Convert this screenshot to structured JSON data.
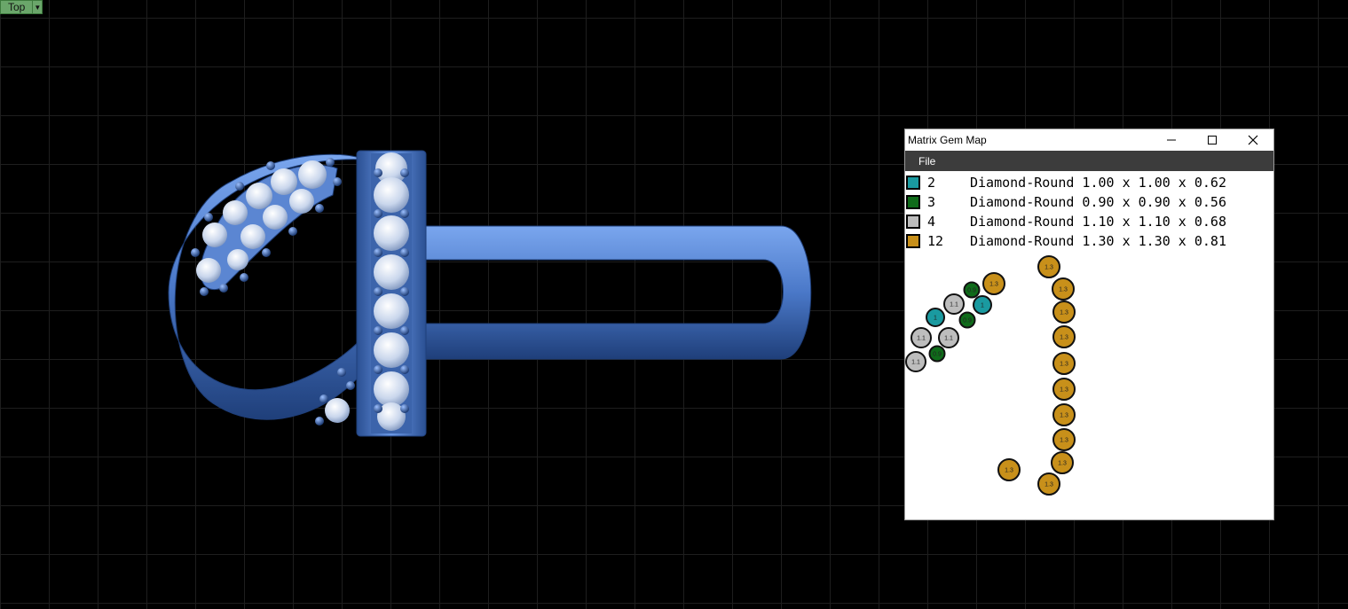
{
  "viewport": {
    "label": "Top",
    "background": "#000000",
    "grid_color": "#1e1e1e",
    "model_color": "#4a78c8"
  },
  "gem_map": {
    "window_title": "Matrix Gem Map",
    "window_controls": [
      "minimize-icon",
      "maximize-icon",
      "close-icon"
    ],
    "menu": [
      "File"
    ],
    "legend": [
      {
        "count": "2",
        "description": "Diamond-Round 1.00 x 1.00 x 0.62",
        "color": "#1a9aa0"
      },
      {
        "count": "3",
        "description": "Diamond-Round 0.90 x 0.90 x 0.56",
        "color": "#0f6b1a"
      },
      {
        "count": "4",
        "description": "Diamond-Round 1.10 x 1.10 x 0.68",
        "color": "#bdbdbd"
      },
      {
        "count": "12",
        "description": "Diamond-Round 1.30 x 1.30 x 0.81",
        "color": "#c8901a"
      }
    ],
    "gems": [
      {
        "label": "1.3",
        "size": "1.3"
      },
      {
        "label": "1.3",
        "size": "1.3"
      },
      {
        "label": "1.3",
        "size": "1.3"
      },
      {
        "label": "1.3",
        "size": "1.3"
      },
      {
        "label": "1.3",
        "size": "1.3"
      },
      {
        "label": "1.3",
        "size": "1.3"
      },
      {
        "label": "1.3",
        "size": "1.3"
      },
      {
        "label": "1.3",
        "size": "1.3"
      },
      {
        "label": "1.3",
        "size": "1.3"
      },
      {
        "label": "1.3",
        "size": "1.3"
      },
      {
        "label": "1.3",
        "size": "1.3"
      },
      {
        "label": "1.3",
        "size": "1.3"
      },
      {
        "label": "1.1",
        "size": "1.1"
      },
      {
        "label": "1.1",
        "size": "1.1"
      },
      {
        "label": "1.1",
        "size": "1.1"
      },
      {
        "label": "1.1",
        "size": "1.1"
      },
      {
        "label": "1",
        "size": "1.0"
      },
      {
        "label": "1",
        "size": "1.0"
      },
      {
        "label": "0.9",
        "size": "0.9"
      },
      {
        "label": "0.9",
        "size": "0.9"
      },
      {
        "label": "0.9",
        "size": "0.9"
      }
    ]
  }
}
